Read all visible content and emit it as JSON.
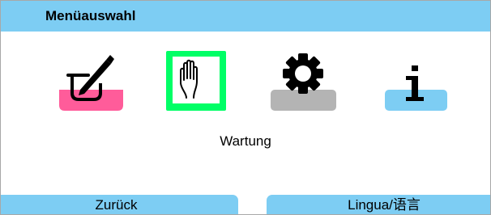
{
  "header": {
    "title": "Menüauswahl"
  },
  "menu": {
    "items": [
      {
        "name": "measurement",
        "icon": "beaker-pen-icon",
        "color": "#ff5c9a"
      },
      {
        "name": "maintenance",
        "icon": "hand-icon",
        "color": "#00ff66",
        "selected": true
      },
      {
        "name": "settings",
        "icon": "gear-icon",
        "color": "#b4b4b4"
      },
      {
        "name": "information",
        "icon": "info-icon",
        "color": "#7dcdf3"
      }
    ],
    "selected_label": "Wartung"
  },
  "softkeys": {
    "left_label": "Zurück",
    "right_label": "Lingua/语言"
  },
  "colors": {
    "accent": "#7dcdf3"
  }
}
